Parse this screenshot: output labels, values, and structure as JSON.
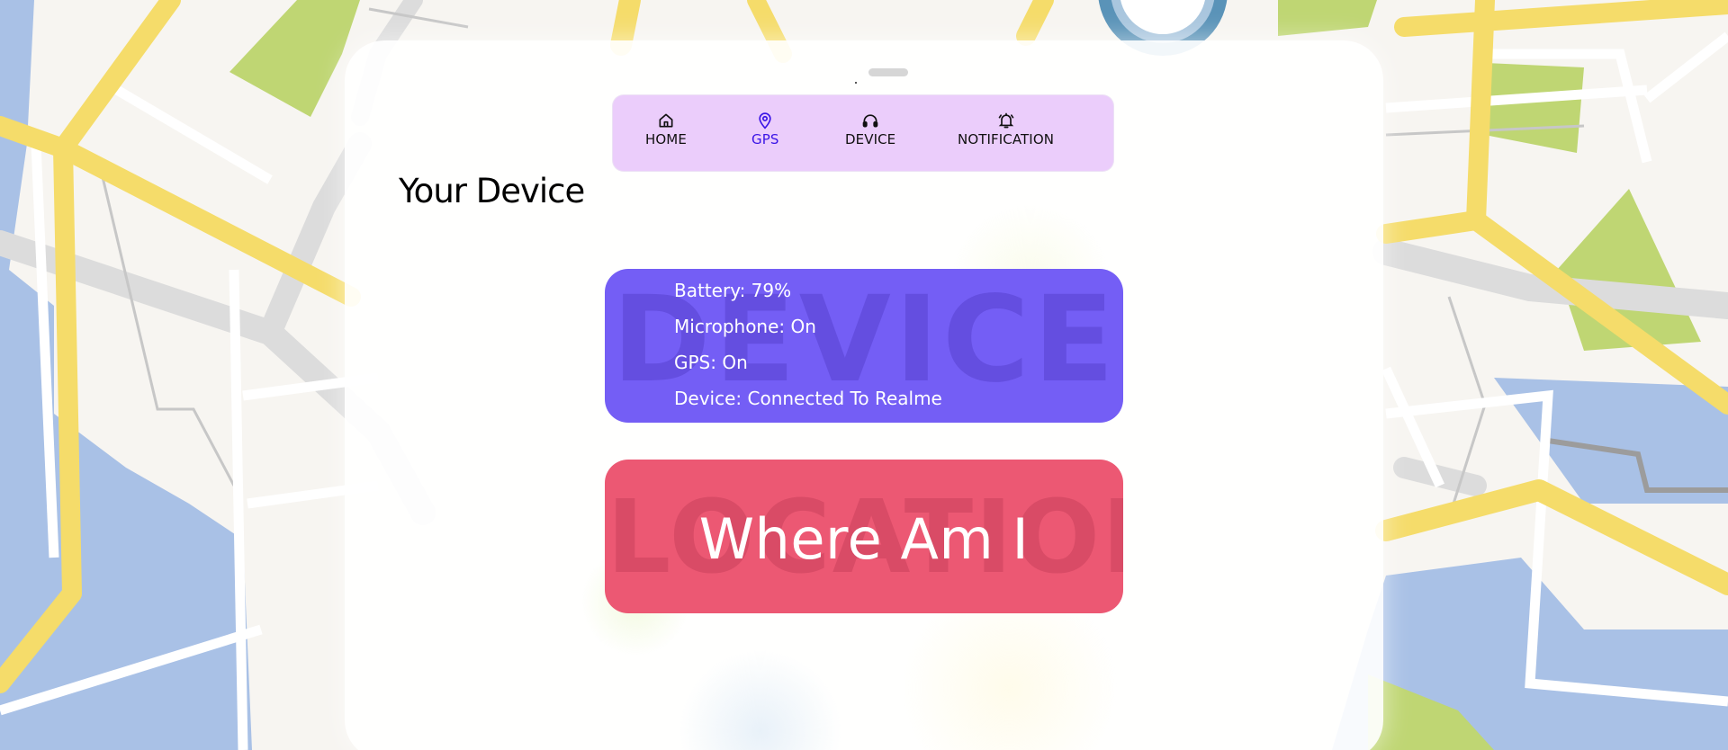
{
  "colors": {
    "nav_background": "#ebcdfb",
    "nav_active": "#3a14e6",
    "device_card": "#745ef5",
    "location_card": "#ec5873",
    "map_road_major": "#f5dc6a",
    "map_water": "#a9c1e6",
    "map_park": "#bfd673"
  },
  "nav": {
    "items": [
      {
        "label": "HOME",
        "icon": "home-icon",
        "active": false
      },
      {
        "label": "GPS",
        "icon": "location-pin-icon",
        "active": true
      },
      {
        "label": "DEVICE",
        "icon": "headphones-icon",
        "active": false
      },
      {
        "label": "NOTIFICATION",
        "icon": "bell-icon",
        "active": false
      }
    ]
  },
  "page": {
    "title": "Your Device"
  },
  "device_card": {
    "watermark": "DEVICE",
    "lines": [
      "Battery: 79%",
      "Microphone: On",
      "GPS: On",
      "Device: Connected To Realme"
    ]
  },
  "location_card": {
    "watermark": "LOCATION",
    "button_label": "Where Am I"
  }
}
